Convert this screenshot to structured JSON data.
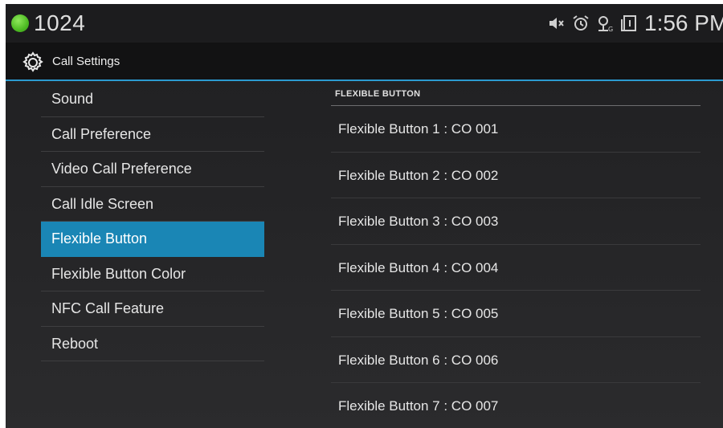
{
  "status_bar": {
    "extension": "1024",
    "time": "1:56 PM",
    "icons": [
      "mute-icon",
      "alarm-icon",
      "gps-icon",
      "sim-icon"
    ],
    "status_color": "#4dbb23"
  },
  "action_bar": {
    "title": "Call Settings",
    "icon": "gear-icon",
    "accent_color": "#2b9ad0"
  },
  "menu": {
    "items": [
      {
        "label": "Sound",
        "selected": false
      },
      {
        "label": "Call Preference",
        "selected": false
      },
      {
        "label": "Video Call Preference",
        "selected": false
      },
      {
        "label": "Call Idle Screen",
        "selected": false
      },
      {
        "label": "Flexible Button",
        "selected": true
      },
      {
        "label": "Flexible Button Color",
        "selected": false
      },
      {
        "label": "NFC Call Feature",
        "selected": false
      },
      {
        "label": "Reboot",
        "selected": false
      }
    ],
    "selected_color": "#1a86b5"
  },
  "panel": {
    "header": "FLEXIBLE BUTTON",
    "rows": [
      "Flexible Button 1 : CO 001",
      "Flexible Button 2 : CO 002",
      "Flexible Button 3 : CO 003",
      "Flexible Button 4 : CO 004",
      "Flexible Button 5 : CO 005",
      "Flexible Button 6 : CO 006",
      "Flexible Button 7 : CO 007"
    ]
  }
}
